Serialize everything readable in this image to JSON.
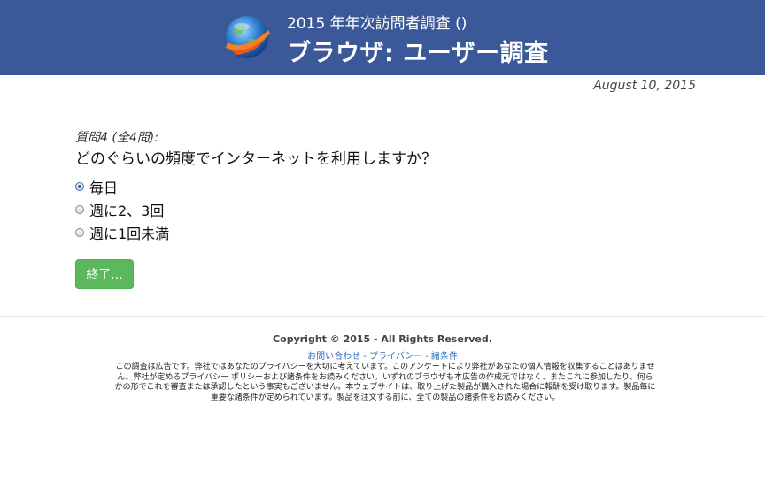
{
  "header": {
    "subtitle": "2015 年年次訪問者調査 ()",
    "title": "ブラウザ: ユーザー調査",
    "logo_icon": "browser-globe-logo-icon"
  },
  "date": "August 10, 2015",
  "question": {
    "number": "質問4 (全4問):",
    "text": "どのぐらいの頻度でインターネットを利用しますか？",
    "options": [
      {
        "label": "毎日",
        "checked": true
      },
      {
        "label": "週に2、3回",
        "checked": false
      },
      {
        "label": "週に1回未満",
        "checked": false
      }
    ]
  },
  "finish_button": "終了...",
  "footer": {
    "copyright": "Copyright © 2015 - All Rights Reserved.",
    "links": [
      "お問い合わせ",
      "プライバシー",
      "諸条件"
    ],
    "separator": " - ",
    "disclaimer": "この調査は広告です。弊社ではあなたのプライバシーを大切に考えています。このアンケートにより弊社があなたの個人情報を収集することはありません。弊社が定めるプライバシー ポリシーおよび諸条件をお読みください。いずれのブラウザも本広告の作成元ではなく、またこれに参加したり、何らかの形でこれを審査または承認したという事実もございません。本ウェブサイトは、取り上げた製品が購入された場合に報酬を受け取ります。製品毎に重要な諸条件が定められています。製品を注文する前に、全ての製品の諸条件をお読みください。"
  },
  "colors": {
    "header_bg": "#3b5998",
    "button_bg": "#5cb85c",
    "link": "#2a6ebb"
  }
}
